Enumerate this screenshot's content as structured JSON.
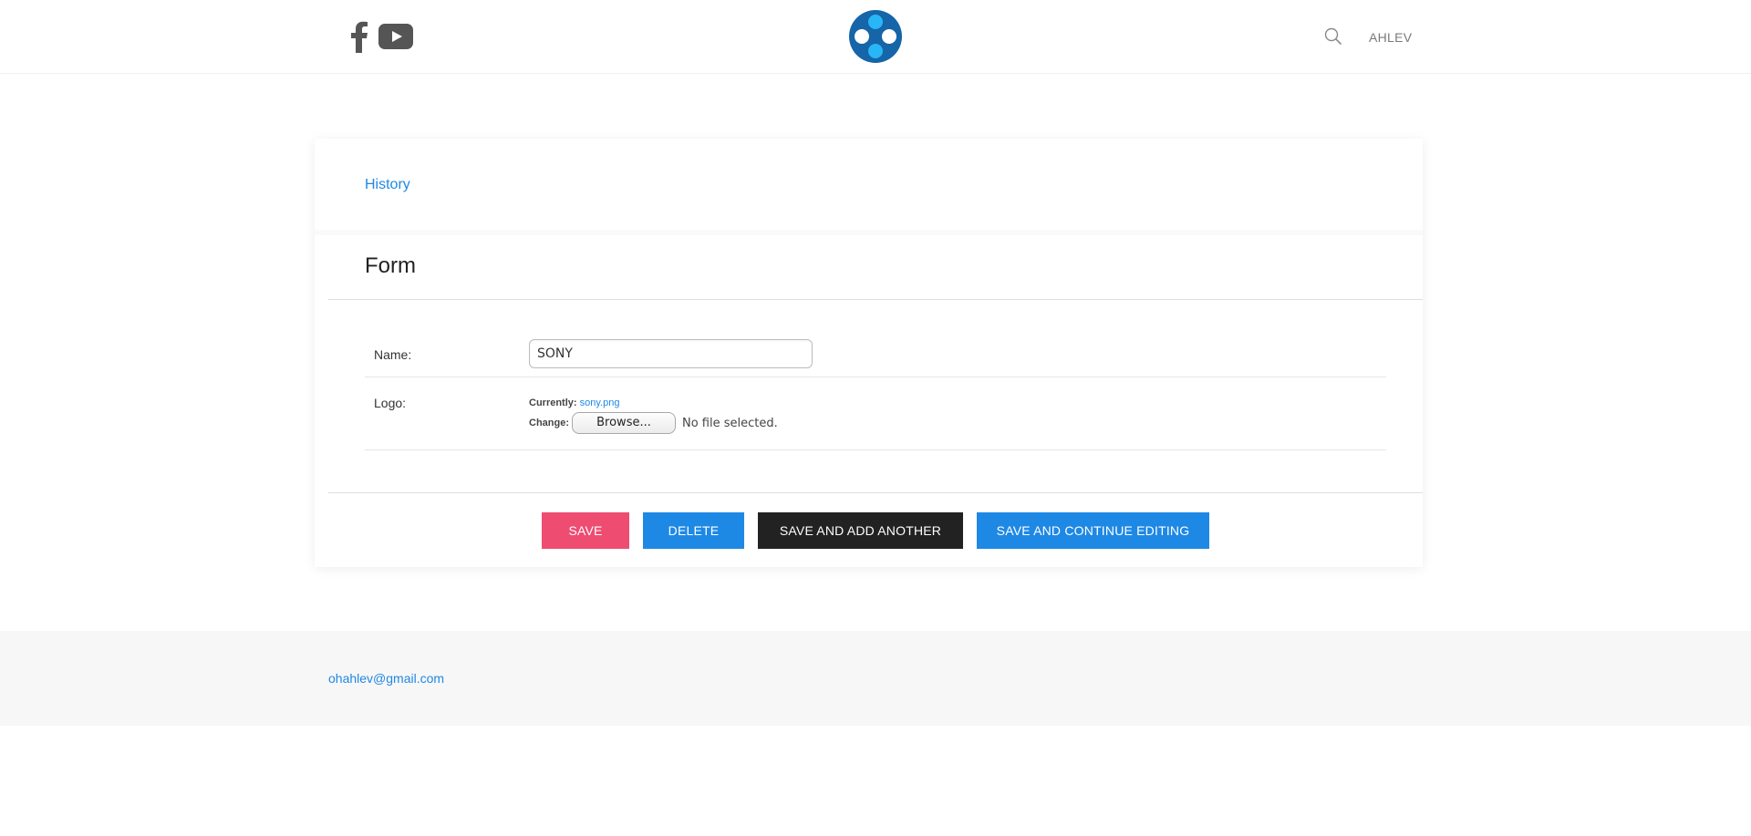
{
  "header": {
    "social": {
      "facebook_icon": "facebook-icon",
      "youtube_icon": "youtube-icon"
    },
    "logo_icon": "film-reel-logo",
    "search_icon": "search-icon",
    "user_label": "AHLEV"
  },
  "card": {
    "history_label": "History",
    "form_title": "Form",
    "fields": {
      "name_label": "Name:",
      "name_value": "SONY",
      "logo_label": "Logo:",
      "currently_label": "Currently:",
      "currently_file": "sony.png",
      "change_label": "Change:",
      "browse_label": "Browse...",
      "no_file_text": "No file selected."
    },
    "buttons": {
      "save": "SAVE",
      "delete": "DELETE",
      "save_add_another": "SAVE AND ADD ANOTHER",
      "save_continue": "SAVE AND CONTINUE EDITING"
    }
  },
  "footer": {
    "email": "ohahlev@gmail.com"
  },
  "colors": {
    "accent_blue": "#1e88e5",
    "save_pink": "#ee4c71",
    "dark_button": "#222222",
    "logo_dark": "#1565a8",
    "logo_light": "#29b6f6",
    "footer_bg": "#f7f7f7"
  }
}
